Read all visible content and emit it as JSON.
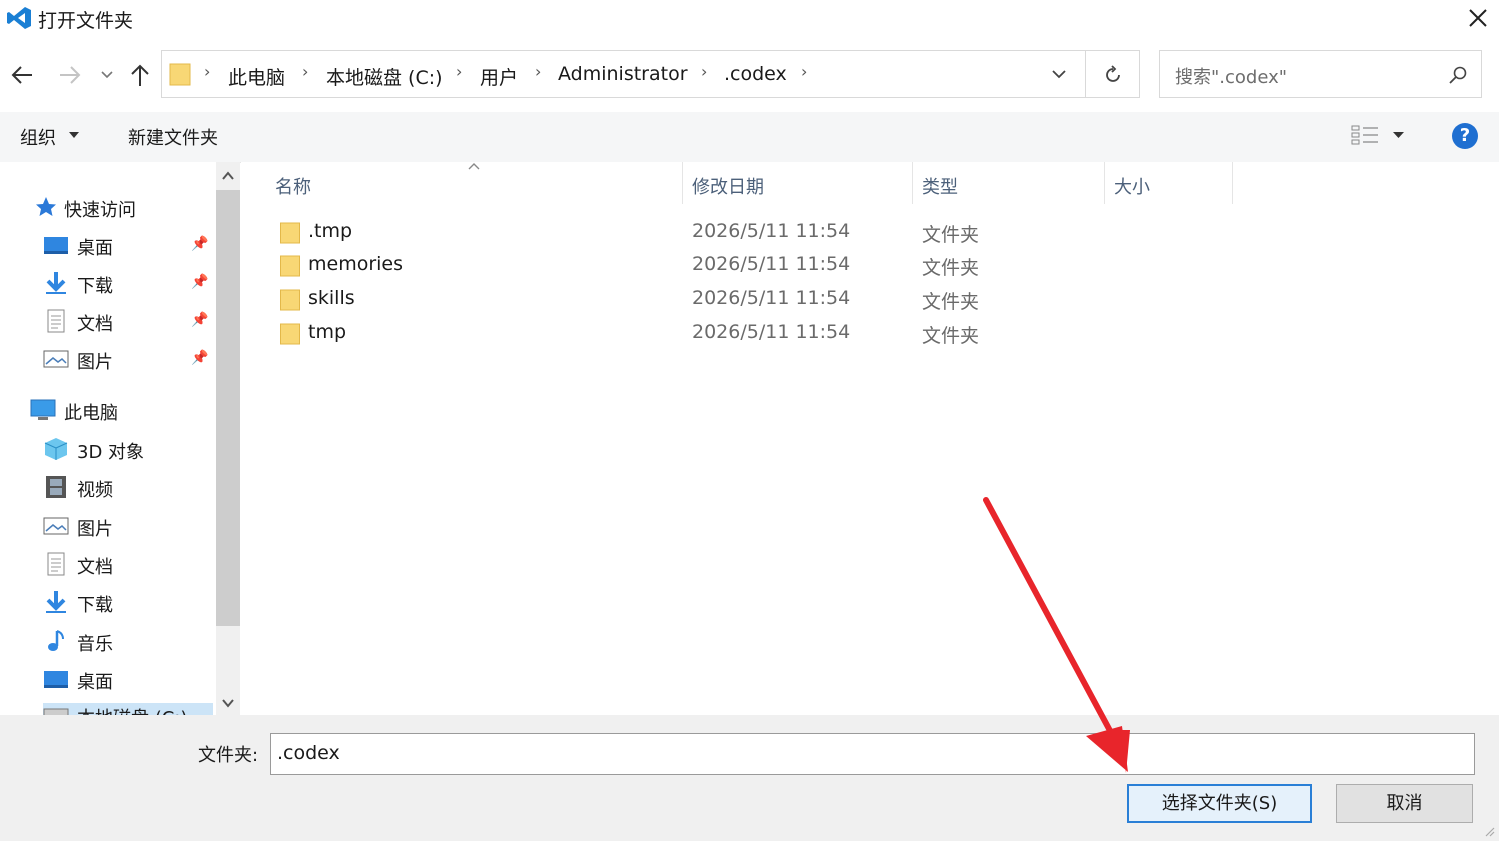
{
  "window": {
    "title": "打开文件夹"
  },
  "address": {
    "crumbs": [
      "此电脑",
      "本地磁盘 (C:)",
      "用户",
      "Administrator",
      ".codex"
    ],
    "search_placeholder": "搜索\".codex\""
  },
  "toolbar": {
    "organize_label": "组织",
    "new_folder_label": "新建文件夹",
    "help_label": "?"
  },
  "nav": {
    "quick_access": "快速访问",
    "quick_items": [
      "桌面",
      "下载",
      "文档",
      "图片"
    ],
    "this_pc": "此电脑",
    "pc_items": [
      "3D 对象",
      "视频",
      "图片",
      "文档",
      "下载",
      "音乐",
      "桌面",
      "本地磁盘 (C:)"
    ]
  },
  "columns": {
    "name": "名称",
    "date": "修改日期",
    "type": "类型",
    "size": "大小"
  },
  "files": [
    {
      "name": ".tmp",
      "date": "2026/5/11 11:54",
      "type": "文件夹"
    },
    {
      "name": "memories",
      "date": "2026/5/11 11:54",
      "type": "文件夹"
    },
    {
      "name": "skills",
      "date": "2026/5/11 11:54",
      "type": "文件夹"
    },
    {
      "name": "tmp",
      "date": "2026/5/11 11:54",
      "type": "文件夹"
    }
  ],
  "footer": {
    "folder_label": "文件夹:",
    "folder_value": ".codex",
    "select_button": "选择文件夹(S)",
    "cancel_button": "取消"
  },
  "colors": {
    "accent": "#1f6fd1",
    "folder": "#f8d775",
    "annotation_arrow": "#e8252b"
  }
}
